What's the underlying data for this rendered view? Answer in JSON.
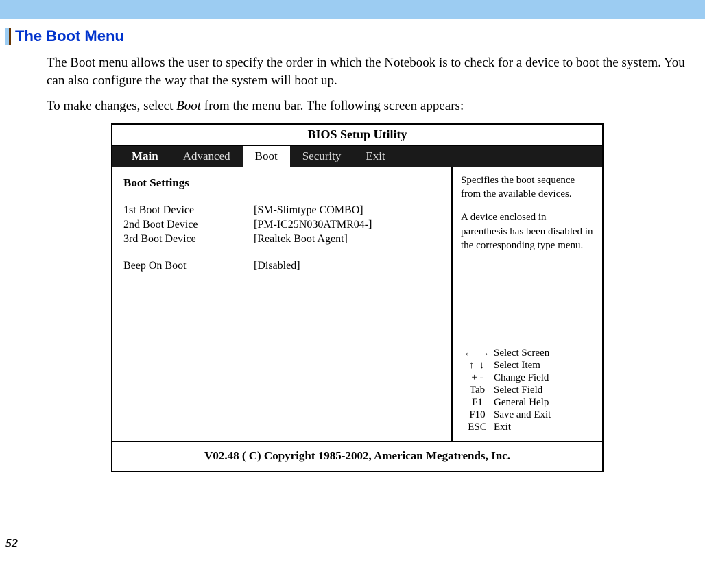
{
  "section_title": "The Boot Menu",
  "paragraphs": {
    "p1": "The Boot menu allows the user to specify the order in which the Notebook is to check for a device to boot the system. You can also configure the way that the system will boot up.",
    "p2_a": "To make changes, select ",
    "p2_italic": "Boot",
    "p2_b": " from the menu bar. The following screen appears:"
  },
  "bios": {
    "title": "BIOS Setup Utility",
    "tabs": {
      "main": "Main",
      "advanced": "Advanced",
      "boot": "Boot",
      "security": "Security",
      "exit": "Exit"
    },
    "settings_title": "Boot Settings",
    "settings": [
      {
        "label": "1st Boot Device",
        "value": "[SM-Slimtype COMBO]"
      },
      {
        "label": "2nd Boot Device",
        "value": "[PM-IC25N030ATMR04-]"
      },
      {
        "label": "3rd Boot Device",
        "value": "[Realtek Boot Agent]"
      }
    ],
    "beep": {
      "label": "Beep On Boot",
      "value": "[Disabled]"
    },
    "help": {
      "p1": "Specifies the boot sequence from the available devices.",
      "p2": "A device enclosed in parenthesis has been disabled in the corresponding type menu."
    },
    "keys": [
      {
        "sym": "← →",
        "desc": "Select Screen",
        "cls": "arrow-lr"
      },
      {
        "sym": "↑ ↓",
        "desc": "Select Item",
        "cls": "arrow-ud"
      },
      {
        "sym": "+ -",
        "desc": "Change Field",
        "cls": ""
      },
      {
        "sym": "Tab",
        "desc": "Select Field",
        "cls": ""
      },
      {
        "sym": "F1",
        "desc": "General Help",
        "cls": ""
      },
      {
        "sym": "F10",
        "desc": "Save and Exit",
        "cls": ""
      },
      {
        "sym": "ESC",
        "desc": "Exit",
        "cls": ""
      }
    ],
    "footer": "V02.48  ( C) Copyright 1985-2002, American Megatrends, Inc."
  },
  "page_number": "52"
}
